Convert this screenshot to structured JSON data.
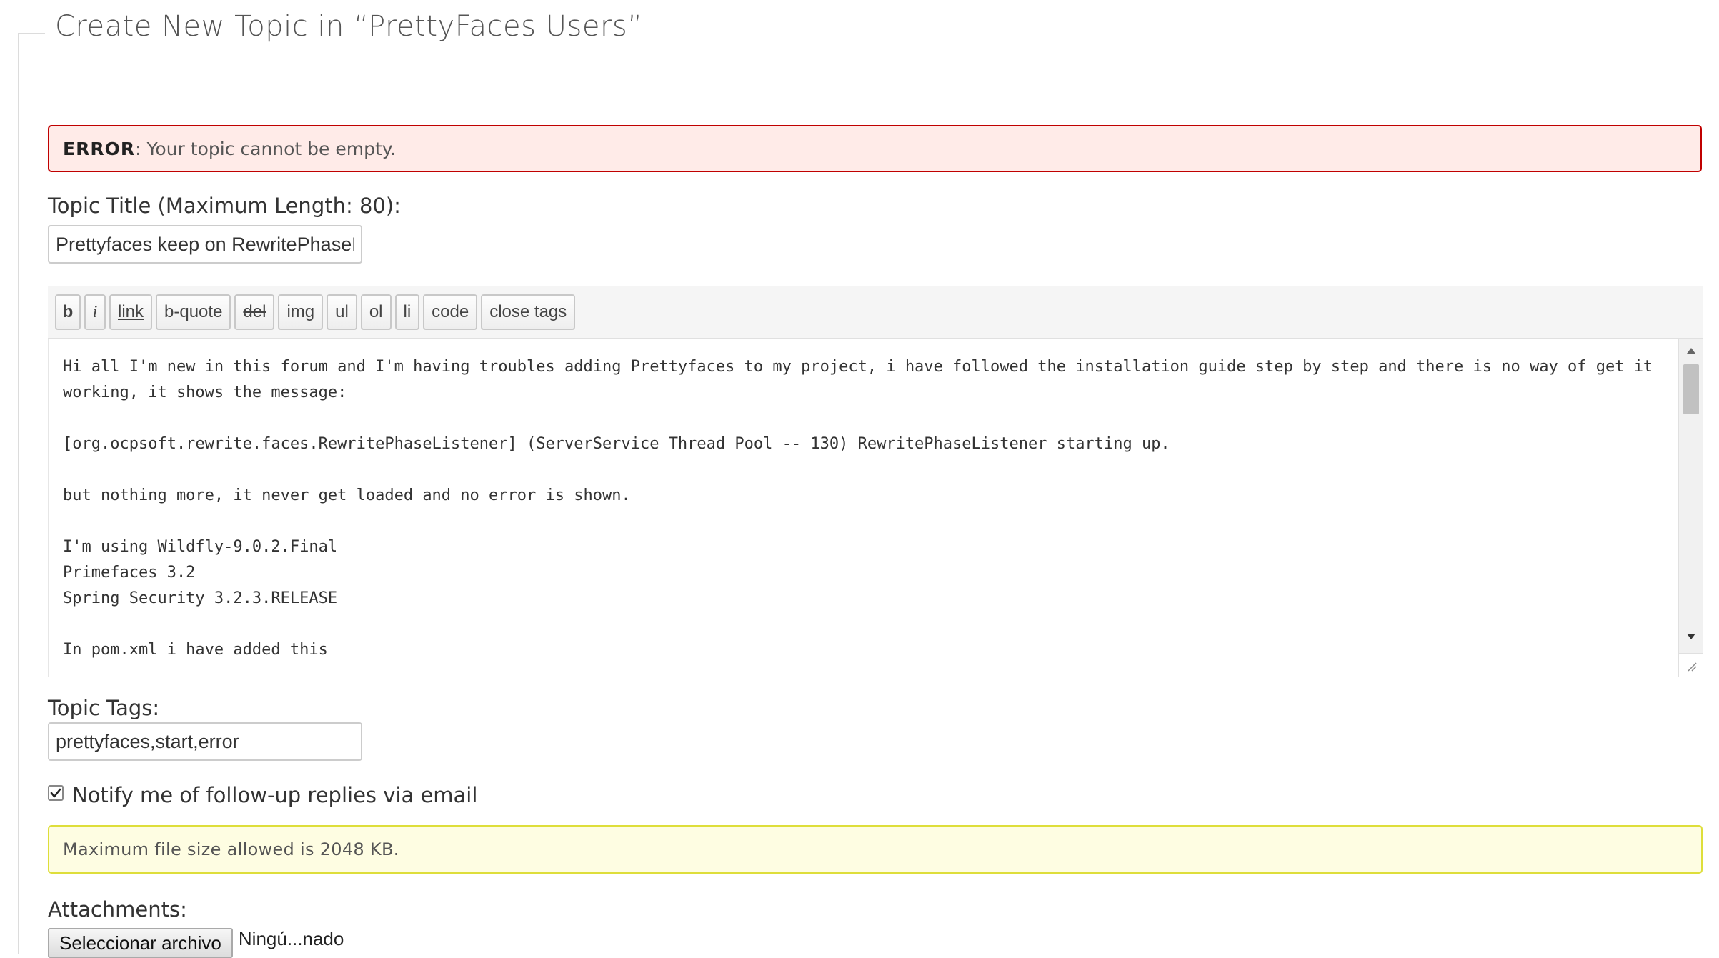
{
  "form": {
    "legend": "Create New Topic in “PrettyFaces Users”",
    "error": {
      "label": "ERROR",
      "message": ": Your topic cannot be empty."
    },
    "title_field": {
      "label": "Topic Title (Maximum Length: 80):",
      "value": "Prettyfaces keep on RewritePhaseListener"
    },
    "toolbar": {
      "bold": "b",
      "italic": "i",
      "link": "link",
      "bquote": "b-quote",
      "del": "del",
      "img": "img",
      "ul": "ul",
      "ol": "ol",
      "li": "li",
      "code": "code",
      "close_tags": "close tags"
    },
    "content": "Hi all I'm new in this forum and I'm having troubles adding Prettyfaces to my project, i have followed the installation guide step by step and there is no way of get it working, it shows the message:\n\n[org.ocpsoft.rewrite.faces.RewritePhaseListener] (ServerService Thread Pool -- 130) RewritePhaseListener starting up.\n\nbut nothing more, it never get loaded and no error is shown.\n\nI'm using Wildfly-9.0.2.Final\nPrimefaces 3.2\nSpring Security 3.2.3.RELEASE\n\nIn pom.xml i have added this",
    "tags_field": {
      "label": "Topic Tags:",
      "value": "prettyfaces,start,error"
    },
    "notify": {
      "label": "Notify me of follow-up replies via email",
      "checked": true
    },
    "file_notice": "Maximum file size allowed is 2048 KB.",
    "attachments": {
      "label": "Attachments:",
      "button": "Seleccionar archivo",
      "status": "Ningú...nado"
    }
  },
  "colors": {
    "error_border": "#c00000",
    "error_bg": "#ffebe8",
    "notice_border": "#dede3a",
    "notice_bg": "#fefde2"
  },
  "icons": {
    "scroll_up": "triangle-up-icon",
    "scroll_down": "triangle-down-icon",
    "resize": "resize-grip-icon",
    "check": "check-icon"
  }
}
